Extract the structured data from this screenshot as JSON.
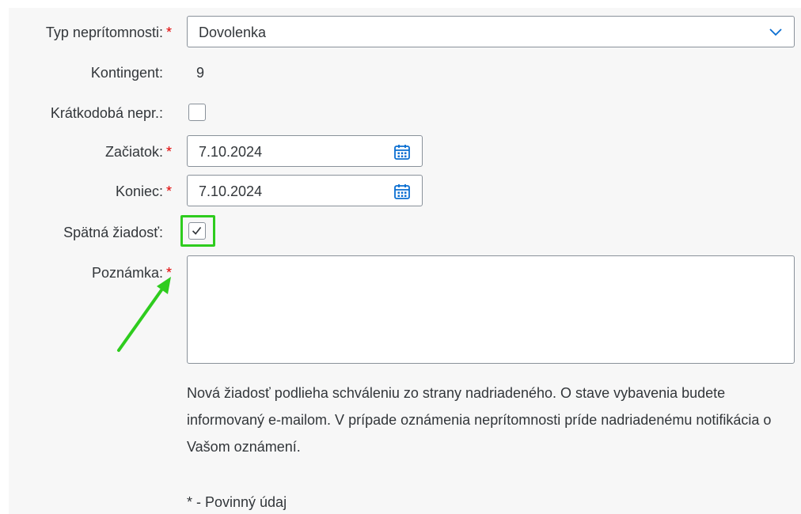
{
  "form": {
    "absence_type": {
      "label": "Typ neprítomnosti:",
      "required": "*",
      "value": "Dovolenka"
    },
    "quota": {
      "label": "Kontingent:",
      "value": "9"
    },
    "short_absence": {
      "label": "Krátkodobá nepr.:",
      "checked": false
    },
    "start": {
      "label": "Začiatok:",
      "required": "*",
      "value": "7.10.2024"
    },
    "end": {
      "label": "Koniec:",
      "required": "*",
      "value": "7.10.2024"
    },
    "retroactive": {
      "label": "Spätná žiadosť:",
      "checked": true
    },
    "note": {
      "label": "Poznámka:",
      "required": "*",
      "value": ""
    }
  },
  "info_text": "Nová žiadosť podlieha schváleniu zo strany nadriadeného. O stave vybavenia budete informovaný e-mailom. V prípade oznámenia neprítomnosti príde nadriadenému notifikácia o Vašom oznámení.",
  "required_note": "* - Povinný údaj",
  "colors": {
    "required": "#e00000",
    "highlight": "#2ecc1e",
    "calendar_icon": "#0a6ed1",
    "border": "#89919a"
  },
  "icons": [
    "chevron-down-icon",
    "calendar-icon",
    "checkmark-icon",
    "annotation-arrow"
  ]
}
